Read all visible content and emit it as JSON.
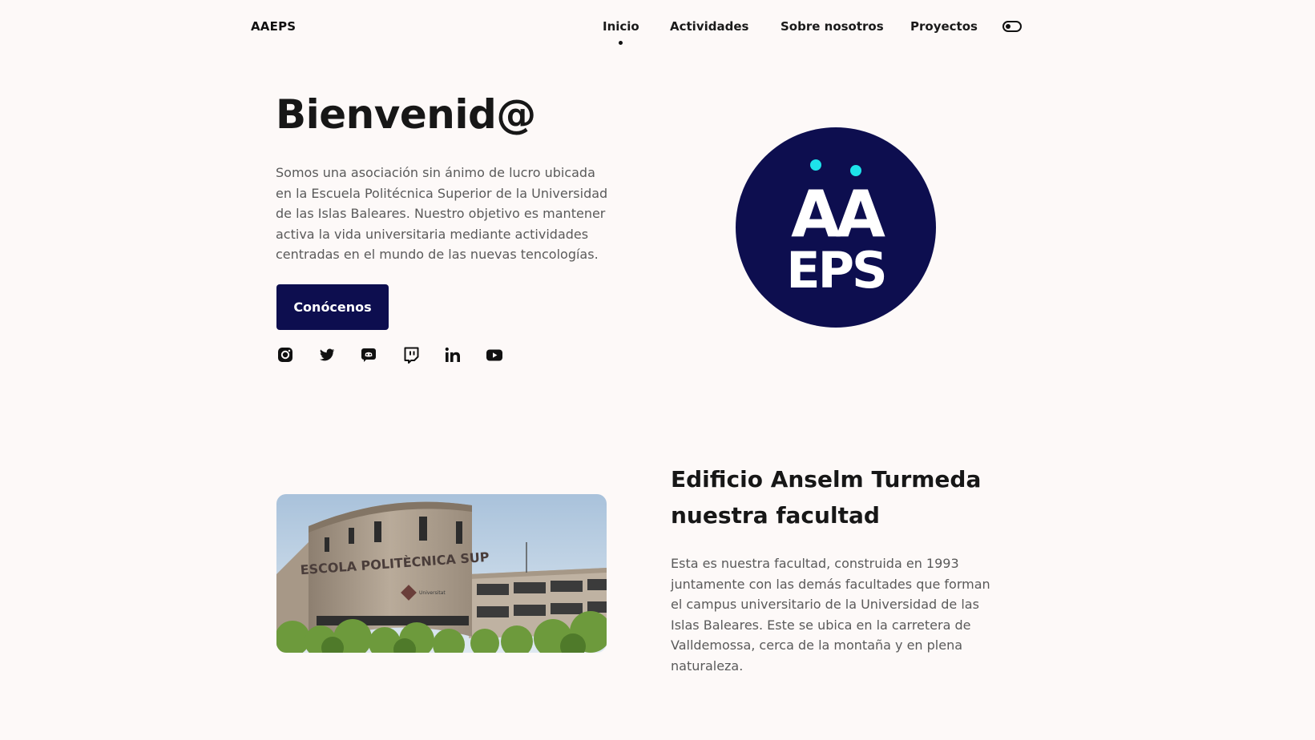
{
  "header": {
    "brand": "AAEPS",
    "nav": [
      {
        "label": "Inicio",
        "active": true
      },
      {
        "label": "Actividades",
        "active": false
      },
      {
        "label": "Sobre nosotros",
        "active": false
      },
      {
        "label": "Proyectos",
        "active": false
      }
    ],
    "theme_toggle_icon": "toggle-icon"
  },
  "hero": {
    "title": "Bienvenid@",
    "description": "Somos una asociación sin ánimo de lucro ubicada en la Escuela Politécnica Superior de la Universidad de las Islas Baleares. Nuestro objetivo es mantener activa la vida universitaria mediante actividades centradas en el mundo de las nuevas tencologías.",
    "cta_label": "Conócenos",
    "social_icons": [
      "instagram-icon",
      "twitter-icon",
      "discord-icon",
      "twitch-icon",
      "linkedin-icon",
      "youtube-icon"
    ],
    "logo": {
      "line1": "AA",
      "line2": "EPS",
      "bg_color": "#0d0e4f",
      "accent_color": "#1ee3ea"
    }
  },
  "facility": {
    "title_line1": "Edificio Anselm Turmeda",
    "title_line2": "nuestra facultad",
    "description": "Esta es nuestra facultad, construida en 1993 juntamente con las demás facultades que forman el campus universitario de la Universidad de las Islas Baleares. Este se ubica en la carretera de Valldemossa, cerca de la montaña y en plena naturaleza.",
    "image_sign": "ESCOLA POLITÈCNICA SUP",
    "image_plaque": "Universitat"
  },
  "colors": {
    "background": "#fdf9f8",
    "primary": "#0d0e4f",
    "accent": "#1ee3ea",
    "text": "#171717",
    "muted_text": "#5a5a5a"
  }
}
